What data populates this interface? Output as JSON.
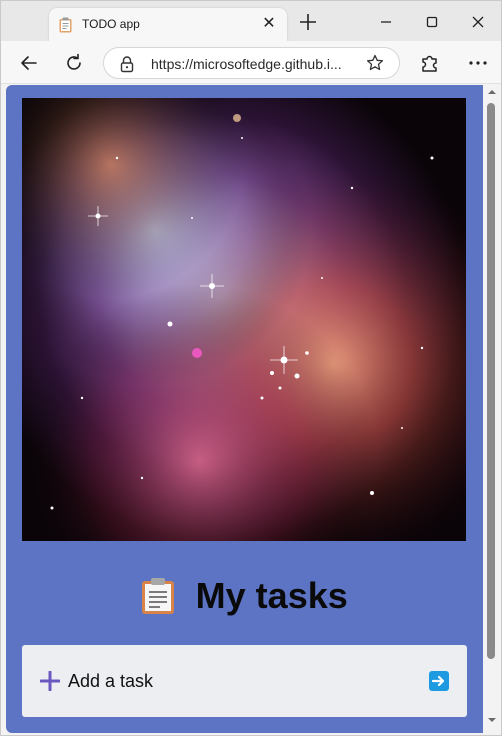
{
  "browser": {
    "tab": {
      "title": "TODO app",
      "favicon": "clipboard-icon",
      "close_icon": "close-icon"
    },
    "new_tab_icon": "plus-icon",
    "window_controls": [
      "minimize-icon",
      "maximize-icon",
      "close-icon"
    ],
    "toolbar": {
      "back_icon": "arrow-left-icon",
      "reload_icon": "reload-icon",
      "url": "https://microsoftedge.github.i...",
      "lock_icon": "lock-icon",
      "favorite_icon": "star-icon",
      "extensions_icon": "puzzle-icon",
      "more_icon": "ellipsis-icon"
    }
  },
  "page": {
    "background_color": "#5d73c4",
    "hero_image": "nebula-space-image",
    "heading": {
      "icon": "clipboard-emoji",
      "text": "My tasks"
    },
    "task_form": {
      "add_icon": "plus-icon",
      "placeholder": "Add a task",
      "submit_icon": "right-arrow-icon"
    }
  }
}
